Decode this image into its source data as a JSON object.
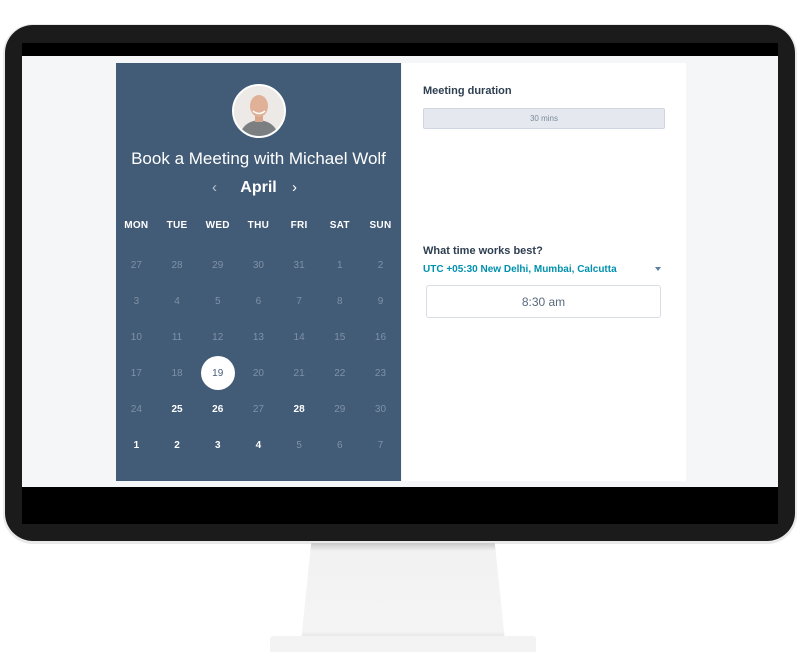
{
  "booking": {
    "title": "Book a Meeting with Michael Wolf",
    "avatar_alt": "Michael Wolf profile photo"
  },
  "calendar": {
    "month": "April",
    "prev_icon": "chevron-left-icon",
    "next_icon": "chevron-right-icon",
    "weekdays": [
      "MON",
      "TUE",
      "WED",
      "THU",
      "FRI",
      "SAT",
      "SUN"
    ],
    "selected_day": "19",
    "weeks": [
      [
        {
          "d": "27",
          "s": "muted"
        },
        {
          "d": "28",
          "s": "muted"
        },
        {
          "d": "29",
          "s": "muted"
        },
        {
          "d": "30",
          "s": "muted"
        },
        {
          "d": "31",
          "s": "muted"
        },
        {
          "d": "1",
          "s": "muted"
        },
        {
          "d": "2",
          "s": "muted"
        }
      ],
      [
        {
          "d": "3",
          "s": "muted"
        },
        {
          "d": "4",
          "s": "muted"
        },
        {
          "d": "5",
          "s": "muted"
        },
        {
          "d": "6",
          "s": "muted"
        },
        {
          "d": "7",
          "s": "muted"
        },
        {
          "d": "8",
          "s": "muted"
        },
        {
          "d": "9",
          "s": "muted"
        }
      ],
      [
        {
          "d": "10",
          "s": "muted"
        },
        {
          "d": "11",
          "s": "muted"
        },
        {
          "d": "12",
          "s": "muted"
        },
        {
          "d": "13",
          "s": "muted"
        },
        {
          "d": "14",
          "s": "muted"
        },
        {
          "d": "15",
          "s": "muted"
        },
        {
          "d": "16",
          "s": "muted"
        }
      ],
      [
        {
          "d": "17",
          "s": "muted"
        },
        {
          "d": "18",
          "s": "muted"
        },
        {
          "d": "19",
          "s": "selected"
        },
        {
          "d": "20",
          "s": "muted"
        },
        {
          "d": "21",
          "s": "muted"
        },
        {
          "d": "22",
          "s": "muted"
        },
        {
          "d": "23",
          "s": "muted"
        }
      ],
      [
        {
          "d": "24",
          "s": "muted"
        },
        {
          "d": "25",
          "s": "avail"
        },
        {
          "d": "26",
          "s": "avail"
        },
        {
          "d": "27",
          "s": "muted"
        },
        {
          "d": "28",
          "s": "avail"
        },
        {
          "d": "29",
          "s": "muted"
        },
        {
          "d": "30",
          "s": "muted"
        }
      ],
      [
        {
          "d": "1",
          "s": "avail"
        },
        {
          "d": "2",
          "s": "avail"
        },
        {
          "d": "3",
          "s": "avail"
        },
        {
          "d": "4",
          "s": "avail"
        },
        {
          "d": "5",
          "s": "muted"
        },
        {
          "d": "6",
          "s": "muted"
        },
        {
          "d": "7",
          "s": "muted"
        }
      ]
    ]
  },
  "duration": {
    "label": "Meeting duration",
    "value": "30 mins"
  },
  "time": {
    "label": "What time works best?",
    "timezone": "UTC +05:30 New Delhi, Mumbai, Calcutta",
    "slots": [
      "8:30 am"
    ]
  },
  "colors": {
    "panel": "#425b76",
    "accent": "#0091ae"
  }
}
